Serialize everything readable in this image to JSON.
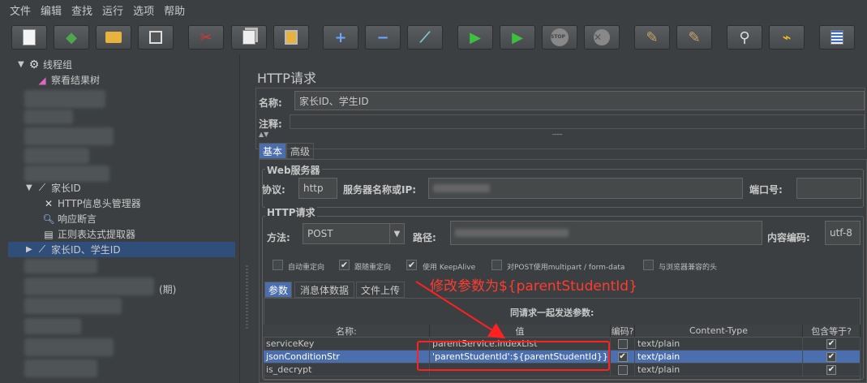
{
  "menu": [
    "文件",
    "编辑",
    "查找",
    "运行",
    "选项",
    "帮助"
  ],
  "toolbar_icons": [
    "new-icon",
    "templates-icon",
    "open-icon",
    "save-icon",
    "cut-icon",
    "copy-icon",
    "paste-icon",
    "expand-icon",
    "collapse-icon",
    "toggle-icon",
    "start-icon",
    "start-no-pause-icon",
    "stop-icon",
    "shutdown-icon",
    "clear-icon",
    "clear-all-icon",
    "search-icon",
    "broom-icon",
    "function-helper-icon"
  ],
  "tree": {
    "root_label": "线程组",
    "view_results_label": "察看结果树",
    "parent_id_label": "家长ID",
    "header_manager_label": "HTTP信息头管理器",
    "response_assertion_label": "响应断言",
    "regex_extractor_label": "正则表达式提取器",
    "selected_label": "家长ID、学生ID",
    "hidden_suffix": "(期)"
  },
  "panel": {
    "title": "HTTP请求",
    "name_label": "名称:",
    "name_value": "家长ID、学生ID",
    "comment_label": "注释:",
    "tabs": [
      "基本",
      "高级"
    ],
    "web_server_legend": "Web服务器",
    "protocol_label": "协议:",
    "protocol_value": "http",
    "server_label": "服务器名称或IP:",
    "port_label": "端口号:",
    "http_request_legend": "HTTP请求",
    "method_label": "方法:",
    "method_value": "POST",
    "path_label": "路径:",
    "encoding_label": "内容编码:",
    "encoding_value": "utf-8",
    "options": [
      "自动重定向",
      "跟随重定向",
      "使用 KeepAlive",
      "对POST使用multipart / form-data",
      "与浏览器兼容的头"
    ],
    "options_checked": [
      false,
      true,
      true,
      false,
      false
    ],
    "sub_tabs": [
      "参数",
      "消息体数据",
      "文件上传"
    ],
    "params_title": "同请求一起发送参数:"
  },
  "table": {
    "columns": [
      "名称:",
      "值",
      "编码?",
      "Content-Type",
      "包含等于?"
    ],
    "rows": [
      {
        "name": "serviceKey",
        "value": "parentService.indexList",
        "encode": false,
        "content_type": "text/plain",
        "include_equals": true
      },
      {
        "name": "jsonConditionStr",
        "value": "'parentStudentId':${parentStudentId}}",
        "encode": true,
        "content_type": "text/plain",
        "include_equals": true
      },
      {
        "name": "is_decrypt",
        "value": "",
        "encode": false,
        "content_type": "text/plain",
        "include_equals": true
      }
    ]
  },
  "annotation": "修改参数为${parentStudentId}",
  "colors": {
    "annotation": "#ff3b30",
    "selection": "#4b6eaf",
    "background": "#3c3f41"
  }
}
